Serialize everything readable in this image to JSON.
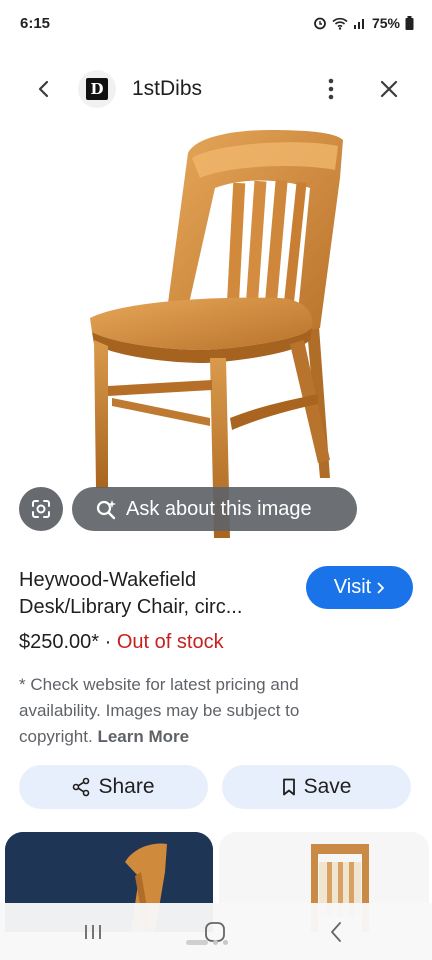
{
  "status": {
    "time": "6:15",
    "battery": "75%"
  },
  "header": {
    "site_logo_letter": "D",
    "site_name": "1stDibs",
    "icons": [
      "back-arrow-icon",
      "more-vert-icon",
      "close-icon"
    ]
  },
  "image_overlay": {
    "ask_label": "Ask about this image"
  },
  "product": {
    "title_line1": "Heywood-Wakefield",
    "title_line2": "Desk/Library Chair, circ...",
    "price": "$250.00*",
    "separator": " · ",
    "stock": "Out of stock",
    "disclaimer": "* Check website for latest pricing and availability. Images may be subject to copyright.",
    "learn_more": "Learn More",
    "visit_label": "Visit"
  },
  "actions": {
    "share_label": "Share",
    "save_label": "Save"
  },
  "colors": {
    "accent": "#1a73e8",
    "stock_red": "#c5221f",
    "action_bg": "#e8effc"
  }
}
